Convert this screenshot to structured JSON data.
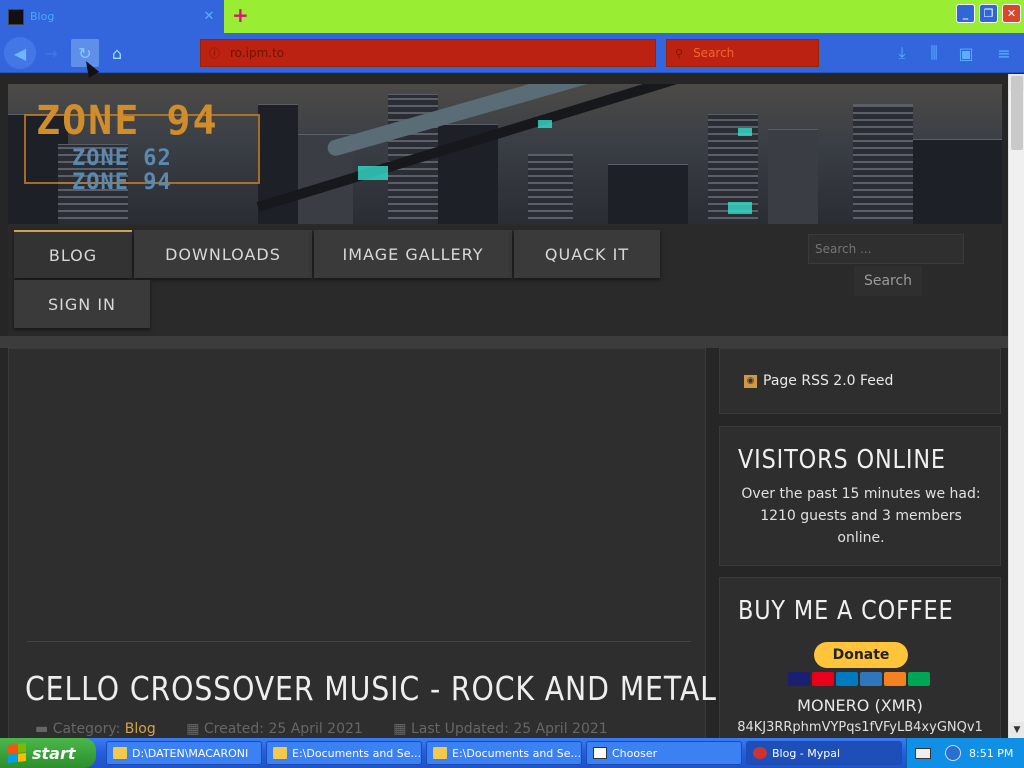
{
  "browser": {
    "tab_title": "Blog",
    "tab_close": "✕",
    "new_tab": "+",
    "url": "ro.ipm.to",
    "search_placeholder": "Search",
    "window_buttons": {
      "minimize": "_",
      "maximize": "❐",
      "close": "✕"
    }
  },
  "site": {
    "logo": "ZONE 94",
    "logo_sub1": "ZONE 62",
    "logo_sub2": "ZONE 94",
    "menu": [
      {
        "label": "BLOG",
        "active": true
      },
      {
        "label": "DOWNLOADS"
      },
      {
        "label": "IMAGE GALLERY"
      },
      {
        "label": "QUACK IT"
      },
      {
        "label": "SIGN IN"
      }
    ],
    "search_placeholder": "Search ...",
    "search_button": "Search"
  },
  "article": {
    "title": "CELLO CROSSOVER MUSIC - ROCK AND METAL",
    "category_label": "Category:",
    "category": "Blog",
    "created": "Created: 25 April 2021",
    "updated": "Last Updated: 25 April 2021"
  },
  "sidebar": {
    "rss": "Page RSS 2.0 Feed",
    "visitors_title": "VISITORS ONLINE",
    "visitors_text": "Over the past 15 minutes we had: 1210 guests and 3 members online.",
    "coffee_title": "BUY ME A COFFEE",
    "donate": "Donate",
    "monero_label": "MONERO (XMR)",
    "monero_address": "84KJ3RRphmVYPqs1fVFyLB4xyGNQv1"
  },
  "taskbar": {
    "start": "start",
    "tasks": [
      "D:\\DATEN\\MACARONI",
      "E:\\Documents and Se...",
      "E:\\Documents and Se...",
      "Chooser",
      "Blog - Mypal"
    ],
    "clock": "8:51 PM"
  },
  "colors": {
    "accent": "#d4a24a",
    "tabbar": "#99ee33",
    "chrome": "#3366dd",
    "urlbar": "#bb2211"
  }
}
